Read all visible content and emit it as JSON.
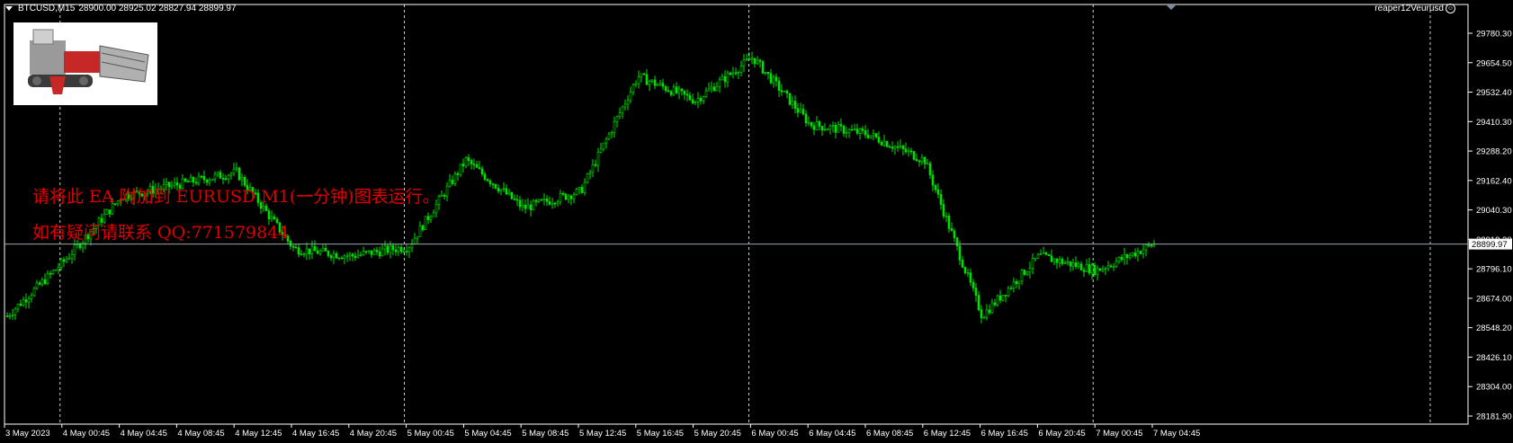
{
  "header": {
    "symbol": "BTCUSD,M15",
    "ohlc": "28900.00 28925.02 28827.94 28899.97"
  },
  "ea_name": "reaper12Veurusd",
  "overlay": {
    "line1": "请将此 EA 附加到 EURUSD M1(一分钟)图表运行。",
    "line2": "如有疑问请联系 QQ:771579844"
  },
  "price_axis": {
    "labels": [
      "29780.30",
      "29654.50",
      "29532.40",
      "29410.30",
      "29288.20",
      "29162.40",
      "29040.30",
      "28918.20",
      "28796.10",
      "28674.00",
      "28548.20",
      "28426.10",
      "28304.00",
      "28181.90"
    ],
    "current_price": "28899.97"
  },
  "time_axis": {
    "labels": [
      "3 May 2023",
      "4 May 00:45",
      "4 May 04:45",
      "4 May 08:45",
      "4 May 12:45",
      "4 May 16:45",
      "4 May 20:45",
      "5 May 00:45",
      "5 May 04:45",
      "5 May 08:45",
      "5 May 12:45",
      "5 May 16:45",
      "5 May 20:45",
      "6 May 00:45",
      "6 May 04:45",
      "6 May 08:45",
      "6 May 12:45",
      "6 May 16:45",
      "6 May 20:45",
      "7 May 00:45",
      "7 May 04:45"
    ]
  },
  "colors": {
    "background": "#000000",
    "candle": "#00e000",
    "grid": "#ffffff",
    "axis_text": "#ffffff",
    "overlay_text": "#e00000",
    "price_line": "#9aa6b0"
  },
  "chart_data": {
    "type": "line",
    "title": "",
    "series": [
      {
        "name": "",
        "x": [
          "3 May 2023",
          "4 May 00:45",
          "4 May 04:45",
          "4 May 08:45",
          "4 May 12:45",
          "4 May 16:45",
          "4 May 20:45",
          "5 May 00:45",
          "5 May 04:45",
          "5 May 08:45",
          "5 May 12:45",
          "5 May 16:45",
          "5 May 20:45",
          "6 May 00:45",
          "6 May 04:45",
          "6 May 08:45",
          "6 May 12:45",
          "6 May 16:45",
          "6 May 20:45",
          "7 May 00:45",
          "7 May 04:45"
        ],
        "values": [
          28600,
          28830,
          29100,
          29150,
          29200,
          28880,
          28850,
          28890,
          29250,
          29050,
          29120,
          29600,
          29500,
          29680,
          29400,
          29360,
          29250,
          28600,
          28850,
          28790,
          28900
        ]
      }
    ],
    "xlabel": "",
    "ylabel": "",
    "ylim": [
      28181.9,
      29780.3
    ],
    "grid": true
  }
}
